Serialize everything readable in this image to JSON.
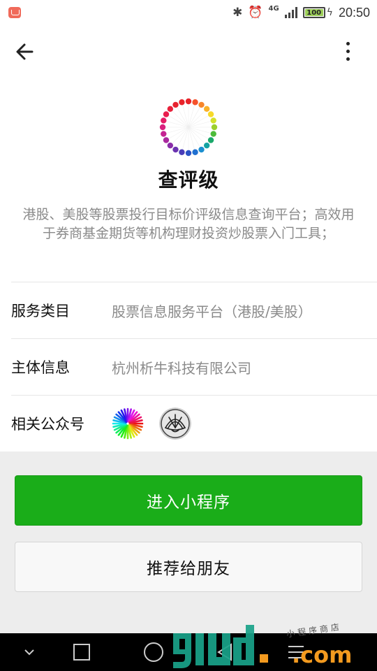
{
  "status_bar": {
    "time": "20:50",
    "network": "4G",
    "battery": "100",
    "battery_level": 1.0
  },
  "header": {
    "back_icon": "arrow-left-icon",
    "more_icon": "more-vertical-icon"
  },
  "app": {
    "title": "查评级",
    "description": "港股、美股等股票投行目标价评级信息查询平台；高效用于券商基金期货等机构理财投资炒股票入门工具；"
  },
  "info": {
    "service_label": "服务类目",
    "service_value": "股票信息服务平台（港股/美股）",
    "entity_label": "主体信息",
    "entity_value": "杭州析牛科技有限公司",
    "accounts_label": "相关公众号"
  },
  "actions": {
    "enter_label": "进入小程序",
    "share_label": "推荐给朋友"
  },
  "watermark": {
    "brand": ".com",
    "sub": "小程序商店"
  },
  "colors": {
    "primary": "#1aad19",
    "background": "#ededed",
    "secondary_text": "#8a8a8a"
  }
}
